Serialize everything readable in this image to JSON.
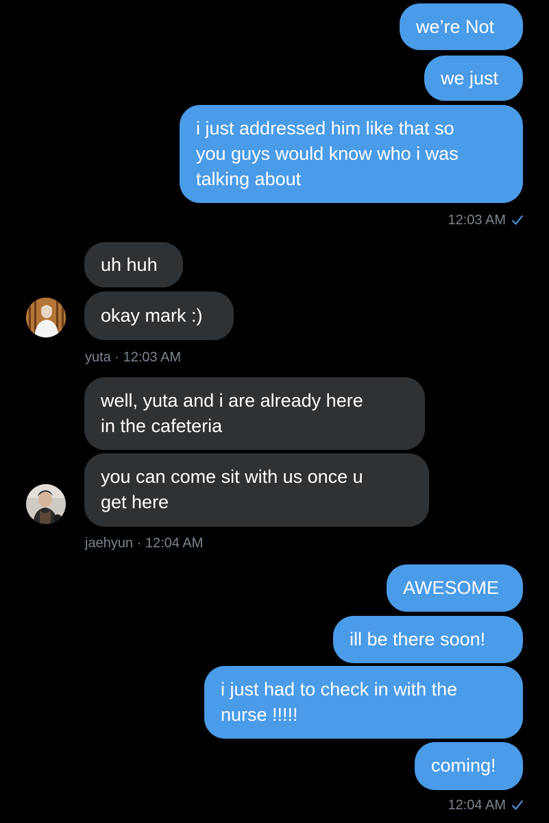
{
  "colors": {
    "background": "#000000",
    "outgoing_bubble": "#4a9be8",
    "incoming_bubble": "#2f3235",
    "meta_text": "#7b8590",
    "read_check": "#4a9be8"
  },
  "messages": {
    "out_group_1": [
      "we’re Not",
      "we just",
      "i just addressed him like that so\nyou guys would know who i was\ntalking about"
    ],
    "out_group_1_time": "12:03 AM",
    "yuta_group": [
      "uh huh",
      "okay mark :)"
    ],
    "yuta_meta": "yuta · 12:03 AM",
    "jaehyun_group": [
      "well, yuta and i are already here\nin the cafeteria",
      "you can come sit with us once u\nget here"
    ],
    "jaehyun_meta": "jaehyun · 12:04 AM",
    "out_group_2": [
      "AWESOME",
      "ill be there soon!",
      "i just had to check in with the\nnurse !!!!!",
      "coming!"
    ],
    "out_group_2_time": "12:04 AM"
  },
  "icons": {
    "read_receipt": "checkmark-icon",
    "yuta_avatar": "avatar-yuta",
    "jaehyun_avatar": "avatar-jaehyun"
  }
}
